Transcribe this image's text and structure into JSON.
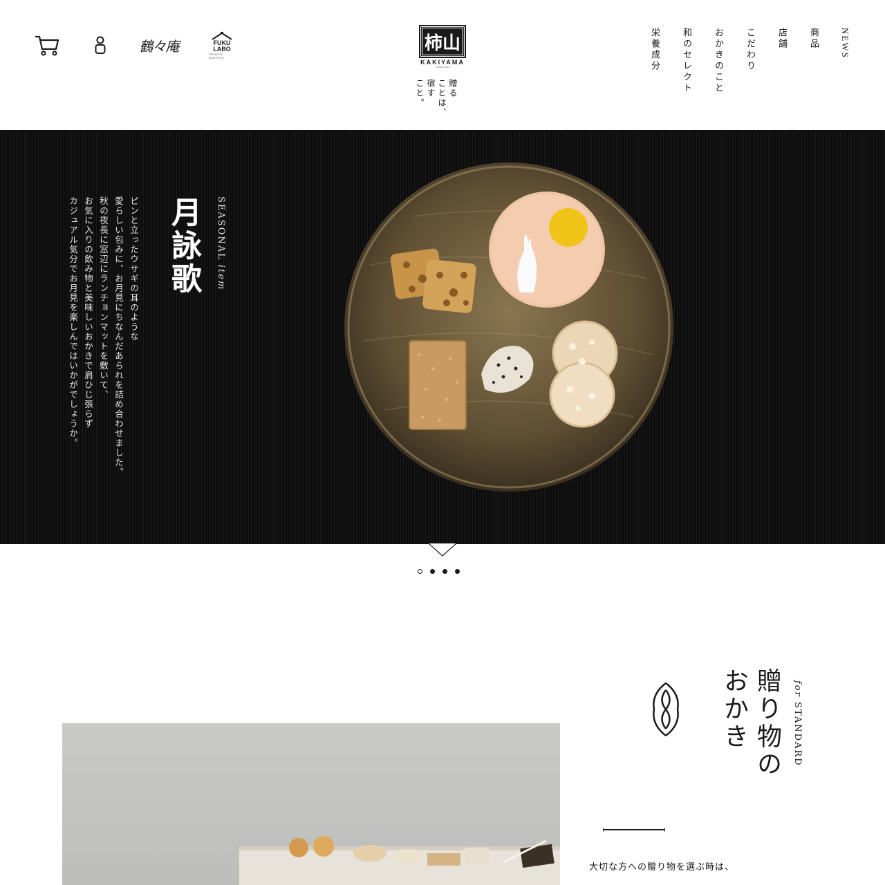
{
  "header": {
    "cart_icon": "cart-icon",
    "account_icon": "person-icon",
    "brand_shop": "鶴々庵",
    "fukulabo": {
      "line1": "FUKU",
      "line2": "LABO",
      "sub": "PROMOTE BEAUTIFUL"
    },
    "logo": {
      "mark": "柿山",
      "name": "KAKIYAMA",
      "sub": "ARARE OKAKI"
    },
    "tagline": [
      "贈る",
      "ことは、",
      "宿す",
      "こと。"
    ],
    "nav": [
      "NEWS",
      "商品",
      "店舗",
      "こだわり",
      "おかきのこと",
      "和のセレクト",
      "栄養成分"
    ]
  },
  "hero": {
    "label_prefix": "SEASONAL",
    "label_suffix": "item",
    "title": "月詠歌",
    "body": [
      "ピンと立ったウサギの耳のような",
      "愛らしい包みに、お月見にちなんだあられを詰め合わせました。",
      "秋の夜長に窓辺にランチョンマットを敷いて、",
      "お気に入りの飲み物と美味しいおかきで肩ひじ張らず",
      "カジュアル気分でお月見を楽しんではいかがでしょうか。"
    ]
  },
  "carousel": {
    "count": 4,
    "active_index": 0
  },
  "standard": {
    "label_prefix": "for",
    "label_suffix": "STANDARD",
    "heading": [
      "贈り物の",
      "おかき"
    ],
    "text": "大切な方への贈り物を選ぶ時は、"
  },
  "colors": {
    "hero_bg": "#111111",
    "plate": "#6b5a3c",
    "moon": "#f0c419"
  }
}
